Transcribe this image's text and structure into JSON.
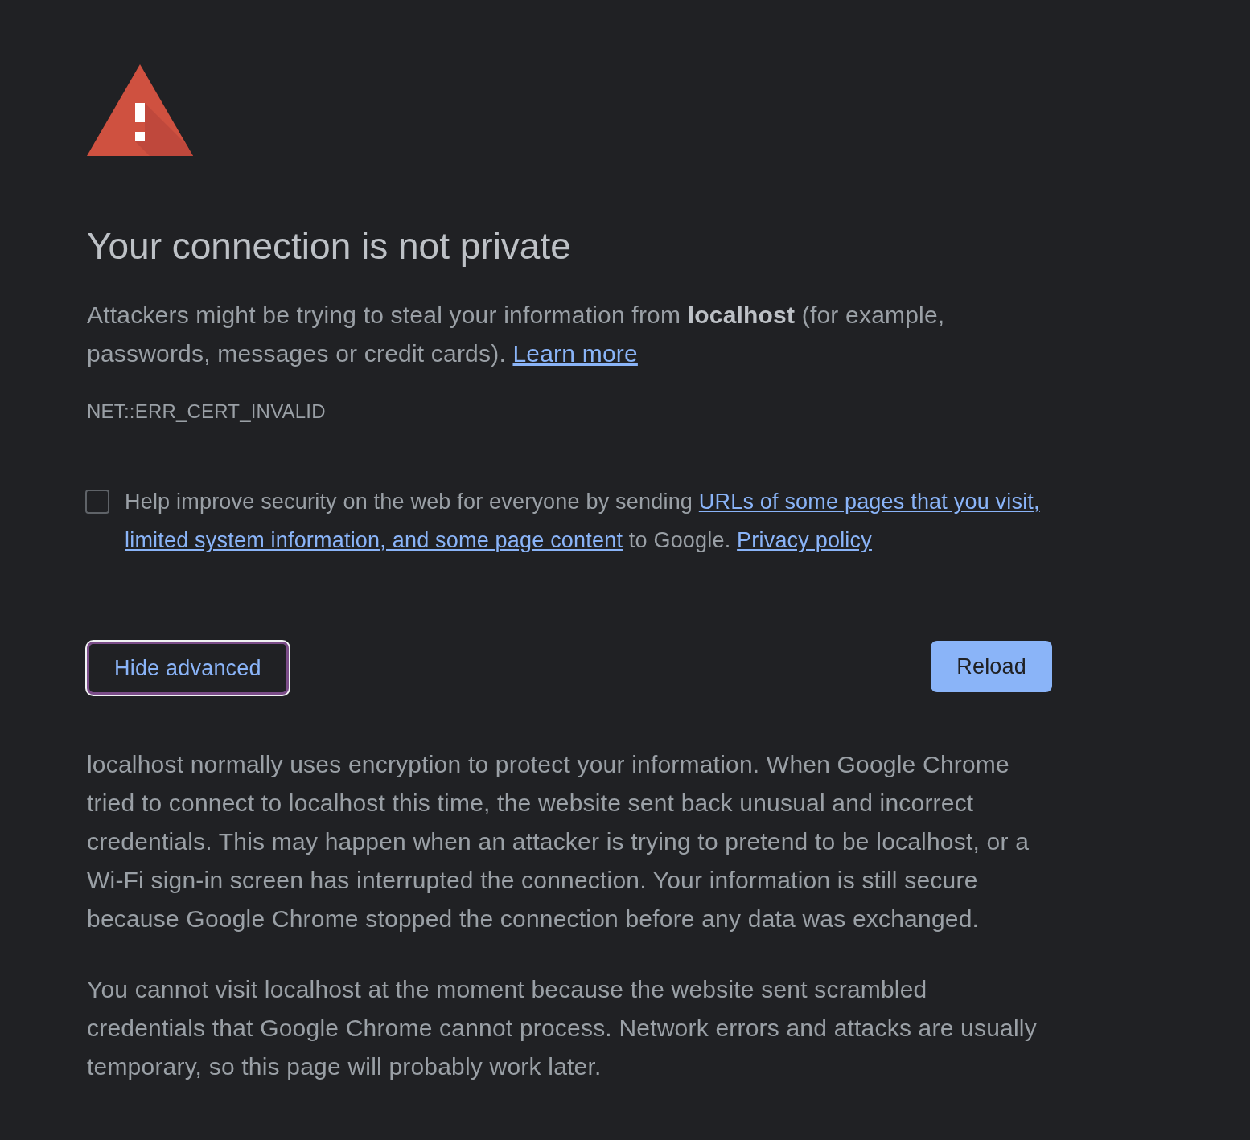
{
  "heading": "Your connection is not private",
  "intro": {
    "text": "Attackers might be trying to steal your information from **localhost** (for example, passwords, messages or credit cards).",
    "link": "Learn more"
  },
  "error_code": "NET::ERR_CERT_INVALID",
  "reporting": {
    "checked": false,
    "segments": [
      {
        "kind": "text",
        "text": "Help improve security on the web for everyone by sending"
      },
      {
        "kind": "link",
        "text": "URLs of some pages that you visit,"
      },
      {
        "kind": "link",
        "text": "limited system information, and some page content"
      },
      {
        "kind": "text",
        "text": "to Google."
      },
      {
        "kind": "policy_link",
        "text": "Privacy policy"
      }
    ]
  },
  "buttons": [
    {
      "label": "Hide advanced",
      "kind": "secondary",
      "focused": true
    },
    {
      "label": "Reload",
      "kind": "primary",
      "focused": false
    }
  ],
  "details": [
    "localhost normally uses encryption to protect your information. When Google Chrome tried to connect to localhost this time, the website sent back unusual and incorrect credentials. This may happen when an attacker is trying to pretend to be localhost, or a Wi-Fi sign-in screen has interrupted the connection. Your information is still secure because Google Chrome stopped the connection before any data was exchanged.",
    "You cannot visit localhost at the moment because the website sent scrambled credentials that Google Chrome cannot process. Network errors and attacks are usually temporary, so this page will probably work later."
  ]
}
